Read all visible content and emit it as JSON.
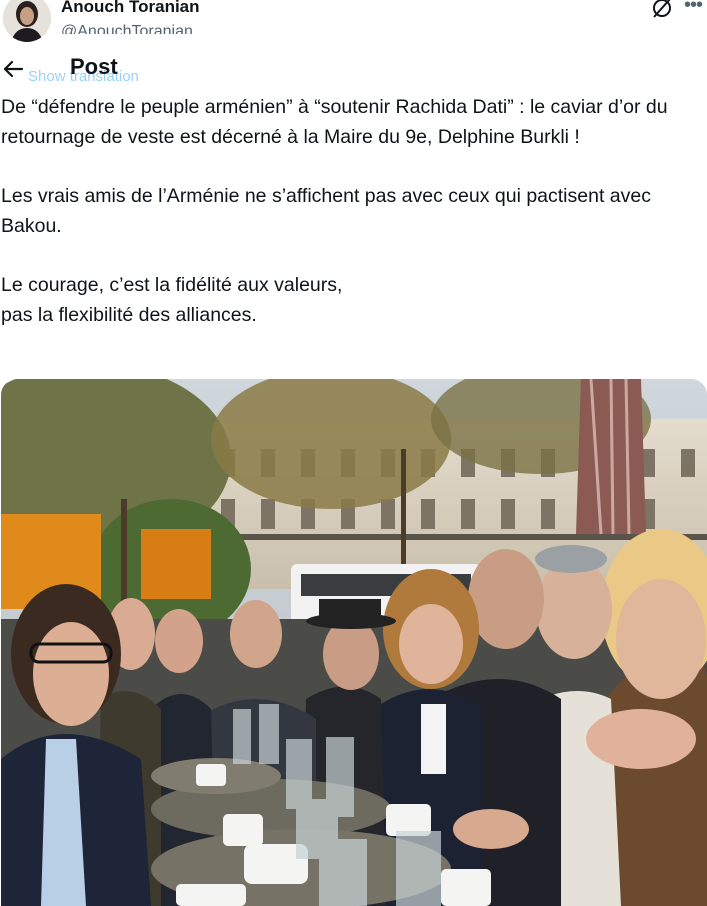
{
  "author": {
    "name": "Anouch Toranian",
    "handle": "@AnouchToranian"
  },
  "header": {
    "back_icon": "arrow-left-icon",
    "title": "Post",
    "show_translation": "Show translation",
    "sync_icon": "grok-icon",
    "more_icon": "more-horizontal-icon"
  },
  "post": {
    "paragraphs": [
      "De “défendre le peuple arménien” à “soutenir Rachida Dati” : le caviar d’or du retournage de veste est décerné à la Maire du 9e, Delphine Burkli !",
      "Les vrais amis de l’Arménie ne s’affichent pas avec ceux qui pactisent avec Bakou.",
      "Le courage, c’est la fidélité aux valeurs,\npas la flexibilité des alliances."
    ]
  },
  "colors": {
    "text": "#0f1419",
    "secondary": "#536471",
    "accent": "#1d9bf0"
  }
}
